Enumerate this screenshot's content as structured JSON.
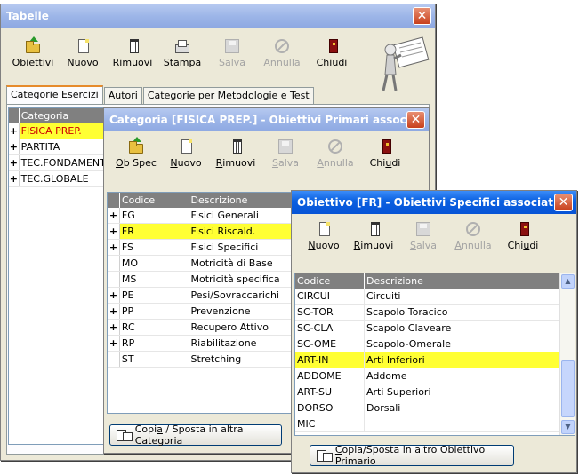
{
  "main_window": {
    "title": "Tabelle",
    "toolbar": [
      {
        "name": "obiettivi-button",
        "icon": "folder-arrow-icon",
        "u": "O",
        "rest": "biettivi",
        "disabled": false
      },
      {
        "name": "nuovo-button",
        "icon": "new-document-icon",
        "u": "N",
        "rest": "uovo",
        "disabled": false
      },
      {
        "name": "rimuovi-button",
        "icon": "trash-icon",
        "u": "R",
        "rest": "imuovi",
        "disabled": false
      },
      {
        "name": "stampa-button",
        "icon": "printer-icon",
        "u": "",
        "pre": "Stam",
        "uu": "p",
        "rest": "a",
        "disabled": false
      },
      {
        "name": "salva-button",
        "icon": "save-icon",
        "u": "S",
        "rest": "alva",
        "disabled": true
      },
      {
        "name": "annulla-button",
        "icon": "cancel-icon",
        "u": "A",
        "rest": "nnulla",
        "disabled": true
      },
      {
        "name": "chiudi-button",
        "icon": "exit-door-icon",
        "pre": "Chi",
        "uu": "u",
        "rest": "di",
        "u": "",
        "disabled": false
      }
    ],
    "tabs": [
      "Categorie Esercizi",
      "Autori",
      "Categorie per Metodologie e Test"
    ],
    "grid": {
      "header": "Categoria",
      "rows": [
        {
          "label": "FISICA PREP.",
          "highlight": true
        },
        {
          "label": "PARTITA",
          "highlight": false
        },
        {
          "label": "TEC.FONDAMENT.",
          "highlight": false
        },
        {
          "label": "TEC.GLOBALE",
          "highlight": false
        }
      ]
    }
  },
  "category_window": {
    "title": "Categoria [FISICA PREP.] - Obiettivi Primari associati",
    "toolbar": [
      {
        "name": "ob-spec-button",
        "icon": "folder-arrow-icon",
        "u": "O",
        "rest": "b Spec",
        "disabled": false
      },
      {
        "name": "nuovo-button",
        "icon": "new-document-icon",
        "u": "N",
        "rest": "uovo",
        "disabled": false
      },
      {
        "name": "rimuovi-button",
        "icon": "trash-icon",
        "u": "R",
        "rest": "imuovi",
        "disabled": false
      },
      {
        "name": "salva-button",
        "icon": "save-icon",
        "u": "S",
        "rest": "alva",
        "disabled": true
      },
      {
        "name": "annulla-button",
        "icon": "cancel-icon",
        "u": "A",
        "rest": "nnulla",
        "disabled": true
      },
      {
        "name": "chiudi-button",
        "icon": "exit-door-icon",
        "pre": "Chi",
        "uu": "u",
        "rest": "di",
        "u": "",
        "disabled": false
      }
    ],
    "grid": {
      "headers": [
        "Codice",
        "Descrizione"
      ],
      "rows": [
        {
          "code": "FG",
          "desc": "Fisici Generali",
          "expand": true,
          "highlight": false
        },
        {
          "code": "FR",
          "desc": "Fisici Riscald.",
          "expand": true,
          "highlight": true
        },
        {
          "code": "FS",
          "desc": "Fisici Specifici",
          "expand": true,
          "highlight": false
        },
        {
          "code": "MO",
          "desc": "Motricità di Base",
          "expand": false,
          "highlight": false
        },
        {
          "code": "MS",
          "desc": "Motricità specifica",
          "expand": false,
          "highlight": false
        },
        {
          "code": "PE",
          "desc": "Pesi/Sovraccarichi",
          "expand": true,
          "highlight": false
        },
        {
          "code": "PP",
          "desc": "Prevenzione",
          "expand": true,
          "highlight": false
        },
        {
          "code": "RC",
          "desc": "Recupero Attivo",
          "expand": true,
          "highlight": false
        },
        {
          "code": "RP",
          "desc": "Riabilitazione",
          "expand": true,
          "highlight": false
        },
        {
          "code": "ST",
          "desc": "Stretching",
          "expand": false,
          "highlight": false
        }
      ]
    },
    "copy_button": {
      "pre": "Copi",
      "u": "a",
      "rest": " / Sposta in altra Categoria"
    }
  },
  "objective_window": {
    "title": "Obiettivo [FR] - Obiettivi Specifici associati",
    "toolbar": [
      {
        "name": "nuovo-button",
        "icon": "new-document-icon",
        "u": "N",
        "rest": "uovo",
        "disabled": false
      },
      {
        "name": "rimuovi-button",
        "icon": "trash-icon",
        "u": "R",
        "rest": "imuovi",
        "disabled": false
      },
      {
        "name": "salva-button",
        "icon": "save-icon",
        "u": "S",
        "rest": "alva",
        "disabled": true
      },
      {
        "name": "annulla-button",
        "icon": "cancel-icon",
        "u": "A",
        "rest": "nnulla",
        "disabled": true
      },
      {
        "name": "chiudi-button",
        "icon": "exit-door-icon",
        "pre": "Chi",
        "uu": "u",
        "rest": "di",
        "u": "",
        "disabled": false
      }
    ],
    "grid": {
      "headers": [
        "Codice",
        "Descrizione"
      ],
      "rows": [
        {
          "code": "CIRCUI",
          "desc": "Circuiti",
          "highlight": false
        },
        {
          "code": "SC-TOR",
          "desc": "Scapolo Toracico",
          "highlight": false
        },
        {
          "code": "SC-CLA",
          "desc": "Scapolo Claveare",
          "highlight": false
        },
        {
          "code": "SC-OME",
          "desc": "Scapolo-Omerale",
          "highlight": false
        },
        {
          "code": "ART-IN",
          "desc": "Arti Inferiori",
          "highlight": true
        },
        {
          "code": "ADDOME",
          "desc": "Addome",
          "highlight": false
        },
        {
          "code": "ART-SU",
          "desc": "Arti Superiori",
          "highlight": false
        },
        {
          "code": "DORSO",
          "desc": "Dorsali",
          "highlight": false
        },
        {
          "code": "MIC",
          "desc": "",
          "highlight": false
        }
      ]
    },
    "copy_button": {
      "pre": "",
      "u": "C",
      "rest": "opia/Sposta in altro Obiettivo Primario"
    }
  },
  "colors": {
    "highlight": "#ffff33",
    "highlight_text_red": "#cc0000",
    "grid_header": "#808080"
  }
}
